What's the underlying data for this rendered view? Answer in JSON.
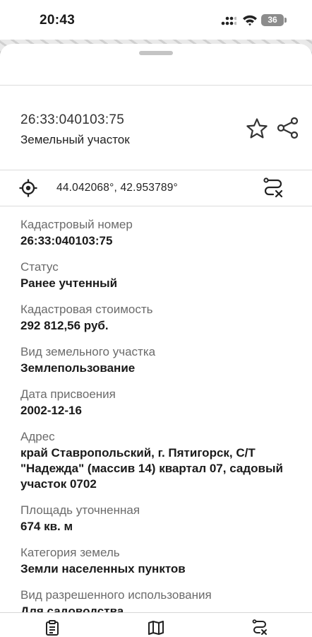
{
  "status_bar": {
    "time": "20:43",
    "battery": "36"
  },
  "card": {
    "cadastral_number": "26:33:040103:75",
    "object_type": "Земельный участок",
    "coordinates": "44.042068°, 42.953789°"
  },
  "fields": [
    {
      "label": "Кадастровый номер",
      "value": "26:33:040103:75"
    },
    {
      "label": "Статус",
      "value": "Ранее учтенный"
    },
    {
      "label": "Кадастровая стоимость",
      "value": "292 812,56 руб."
    },
    {
      "label": "Вид земельного участка",
      "value": "Землепользование"
    },
    {
      "label": "Дата присвоения",
      "value": "2002-12-16"
    },
    {
      "label": "Адрес",
      "value": "край Ставропольский, г. Пятигорск, С/Т \"Надежда\" (массив 14) квартал 07, садовый участок 0702"
    },
    {
      "label": "Площадь уточненная",
      "value": "674 кв. м"
    },
    {
      "label": "Категория земель",
      "value": "Земли населенных пунктов"
    },
    {
      "label": "Вид разрешенного использования",
      "value": "Для садоводства"
    }
  ],
  "icons": {
    "favorite": "star-icon",
    "share": "share-icon",
    "location": "target-icon",
    "route": "route-clear-icon",
    "tab_list": "clipboard-icon",
    "tab_map": "map-icon",
    "tab_route": "route-clear-icon"
  }
}
